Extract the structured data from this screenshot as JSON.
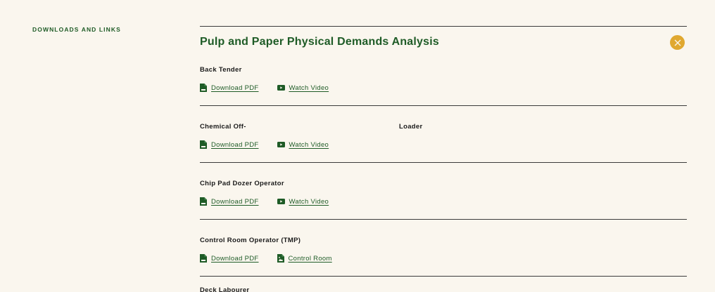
{
  "sidebar": {
    "label": "DOWNLOADS AND LINKS"
  },
  "panel": {
    "title": "Pulp and Paper Physical Demands Analysis",
    "close_icon": "close-icon",
    "entries": [
      {
        "title": "Back Tender",
        "title_2": "",
        "links": [
          {
            "icon": "pdf-file-icon",
            "label": "Download PDF"
          },
          {
            "icon": "video-icon",
            "label": "Watch Video"
          }
        ]
      },
      {
        "title": "Chemical Off-",
        "title_2": "Loader",
        "links": [
          {
            "icon": "pdf-file-icon",
            "label": "Download PDF"
          },
          {
            "icon": "video-icon",
            "label": "Watch Video"
          }
        ]
      },
      {
        "title": "Chip Pad Dozer Operator",
        "title_2": "",
        "links": [
          {
            "icon": "pdf-file-icon",
            "label": "Download PDF"
          },
          {
            "icon": "video-icon",
            "label": "Watch Video"
          }
        ]
      },
      {
        "title": "Control Room Operator (TMP)",
        "title_2": "",
        "links": [
          {
            "icon": "pdf-file-icon",
            "label": "Download PDF"
          },
          {
            "icon": "image-file-icon",
            "label": "Control Room"
          }
        ]
      }
    ],
    "next_entry_partial": "Deck Labourer"
  },
  "colors": {
    "background": "#faf6ee",
    "accent_green": "#1e5b26",
    "close_button": "#e0a830",
    "divider": "#3a3a3a"
  }
}
